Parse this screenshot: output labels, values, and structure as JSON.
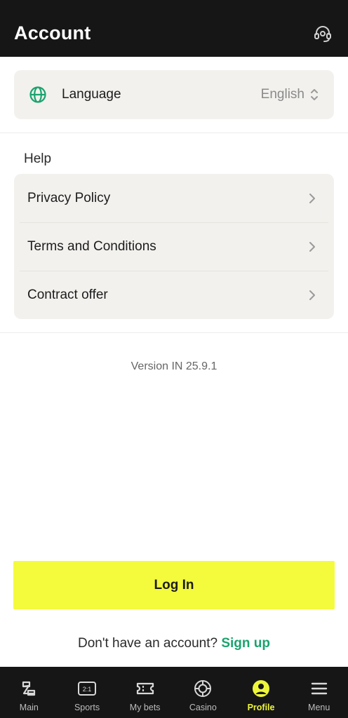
{
  "header": {
    "title": "Account",
    "support_icon": "headset-icon"
  },
  "language": {
    "label": "Language",
    "value": "English",
    "icon": "globe-icon"
  },
  "help": {
    "title": "Help",
    "items": [
      {
        "label": "Privacy Policy"
      },
      {
        "label": "Terms and Conditions"
      },
      {
        "label": "Contract offer"
      }
    ]
  },
  "version": "Version IN 25.9.1",
  "login": {
    "label": "Log In"
  },
  "signup": {
    "prompt": "Don't have an account?",
    "link": "Sign up"
  },
  "bottom_nav": {
    "items": [
      {
        "label": "Main",
        "icon": "main-icon",
        "active": false
      },
      {
        "label": "Sports",
        "icon": "sports-icon",
        "active": false
      },
      {
        "label": "My bets",
        "icon": "ticket-icon",
        "active": false
      },
      {
        "label": "Casino",
        "icon": "casino-chip-icon",
        "active": false
      },
      {
        "label": "Profile",
        "icon": "profile-icon",
        "active": true
      },
      {
        "label": "Menu",
        "icon": "menu-icon",
        "active": false
      }
    ]
  },
  "colors": {
    "header_bg": "#161616",
    "card_bg": "#f2f1ee",
    "accent_green": "#1aa36e",
    "login_yellow": "#f4fa3c",
    "nav_active": "#eef63a"
  }
}
